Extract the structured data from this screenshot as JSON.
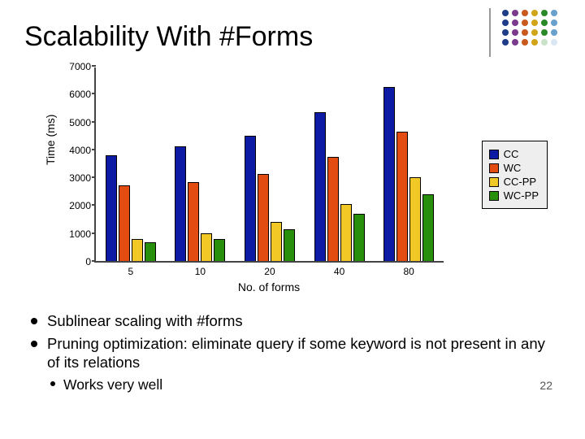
{
  "title": "Scalability With #Forms",
  "bullets": {
    "b1": "Sublinear scaling with #forms",
    "b2": "Pruning optimization: eliminate query if some keyword is not present in any of its relations",
    "b2a": "Works very well"
  },
  "page_number": "22",
  "chart_data": {
    "type": "bar",
    "title": "",
    "xlabel": "No. of forms",
    "ylabel": "Time (ms)",
    "ylim": [
      0,
      7000
    ],
    "yticks": [
      0,
      1000,
      2000,
      3000,
      4000,
      5000,
      6000,
      7000
    ],
    "categories": [
      "5",
      "10",
      "20",
      "40",
      "80"
    ],
    "series": [
      {
        "name": "CC",
        "color": "#0d1aa3",
        "values": [
          3780,
          4100,
          4500,
          5350,
          6250
        ]
      },
      {
        "name": "WC",
        "color": "#e24c10",
        "values": [
          2700,
          2840,
          3120,
          3730,
          4650
        ]
      },
      {
        "name": "CC-PP",
        "color": "#f2c827",
        "values": [
          800,
          1000,
          1400,
          2050,
          3000
        ]
      },
      {
        "name": "WC-PP",
        "color": "#278f0b",
        "values": [
          680,
          800,
          1150,
          1700,
          2400
        ]
      }
    ]
  },
  "deco_colors": [
    "#1f3c88",
    "#7a3b8c",
    "#7a3b8c",
    "#c85a1e",
    "#c85a1e",
    "#d0a51a",
    "#d0a51a",
    "#2a8a2a"
  ]
}
